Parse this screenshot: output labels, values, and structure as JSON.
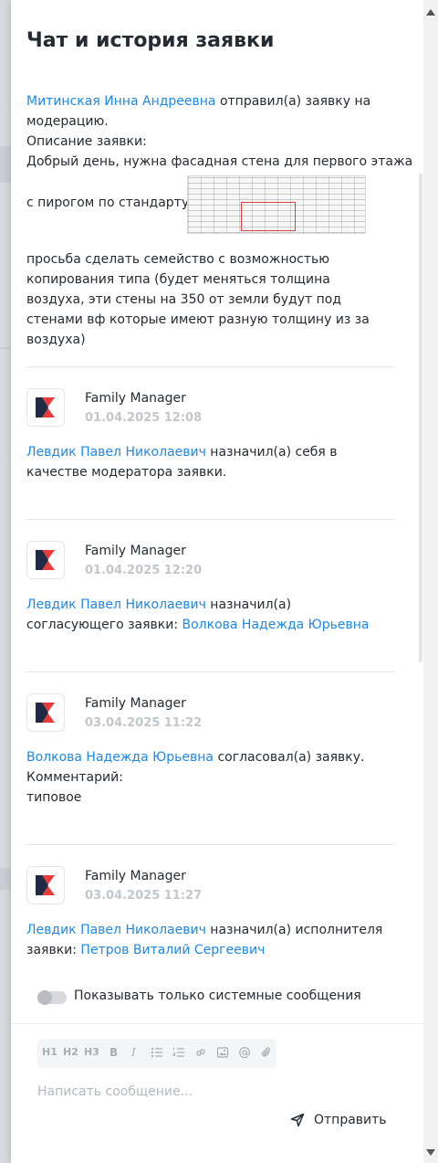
{
  "panel": {
    "title": "Чат и история заявки"
  },
  "first_message": {
    "author_link": "Митинская Инна Андреевна",
    "action": " отправил(а) заявку на модерацию.",
    "desc_label": "Описание заявки:",
    "line1": "Добрый день, нужна фасадная стена для первого этажа",
    "line2": "с пирогом по стандарту",
    "line3": "просьба сделать семейство с возможностью копирования типа (будет меняться толщина воздуха, эти стены на 350 от земли будут под стенами вф которые имеют разную толщину из за воздуха)"
  },
  "events": [
    {
      "author": "Family Manager",
      "time": "01.04.2025 12:08",
      "actor": "Левдик Павел Николаевич",
      "action": " назначил(а) себя в качестве модератора заявки.",
      "target": "",
      "comment_label": "",
      "comment": ""
    },
    {
      "author": "Family Manager",
      "time": "01.04.2025 12:20",
      "actor": "Левдик Павел Николаевич",
      "action": " назначил(а) согласующего заявки: ",
      "target": "Волкова Надежда Юрьевна",
      "comment_label": "",
      "comment": ""
    },
    {
      "author": "Family Manager",
      "time": "03.04.2025 11:22",
      "actor": "Волкова Надежда Юрьевна",
      "action": " согласовал(а) заявку.",
      "target": "",
      "comment_label": "Комментарий:",
      "comment": "типовое"
    },
    {
      "author": "Family Manager",
      "time": "03.04.2025 11:27",
      "actor": "Левдик Павел Николаевич",
      "action": " назначил(а) исполнителя заявки: ",
      "target": "Петров Виталий Сергеевич",
      "comment_label": "",
      "comment": ""
    }
  ],
  "filter": {
    "label": "Показывать только системные сообщения",
    "enabled": false
  },
  "composer": {
    "toolbar": {
      "h1": "H1",
      "h2": "H2",
      "h3": "H3",
      "bold": "B",
      "italic": "I",
      "icons": [
        "bullet-list-icon",
        "numbered-list-icon",
        "link-icon",
        "image-icon",
        "mention-icon",
        "attachment-icon"
      ]
    },
    "placeholder": "Написать сообщение...",
    "send_label": "Отправить"
  },
  "colors": {
    "link": "#1e88e5",
    "text": "#262b33",
    "muted": "#c3c6cc",
    "logo_dark": "#1f2a44",
    "logo_red": "#e63c3c"
  }
}
